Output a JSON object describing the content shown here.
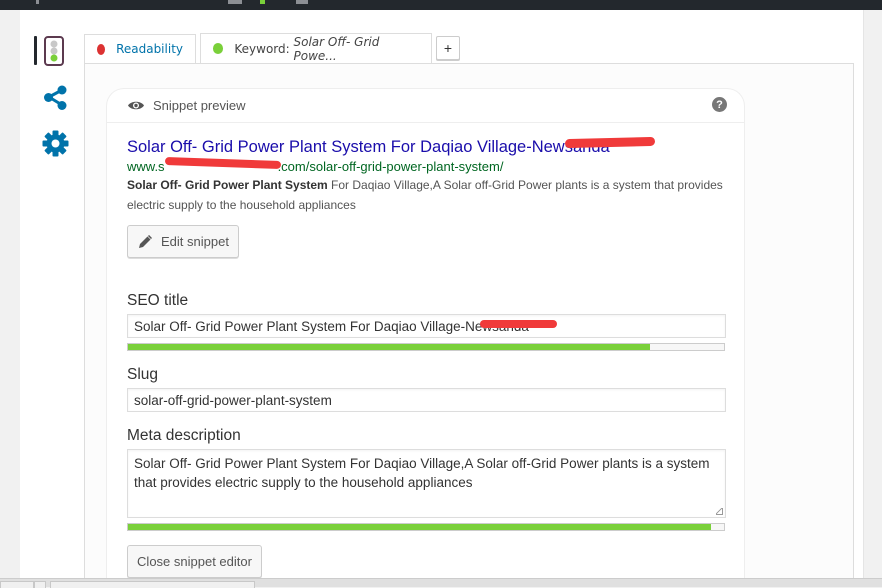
{
  "colors": {
    "readability_status": "#dc3232",
    "keyword_status": "#7ad03a",
    "accent": "#0073aa",
    "serp_title": "#1a0dab",
    "serp_url": "#006621",
    "progress_good": "#7ad03a"
  },
  "sidebar": {
    "items": [
      {
        "icon": "traffic-light-icon",
        "active": true
      },
      {
        "icon": "share-icon"
      },
      {
        "icon": "gear-icon"
      }
    ]
  },
  "tabs": {
    "readability": {
      "label": "Readability",
      "status": "bad"
    },
    "keyword": {
      "prefix": "Keyword: ",
      "keyphrase": "Solar Off- Grid Powe...",
      "status": "good"
    },
    "add_label": "+"
  },
  "snippet": {
    "header": "Snippet preview",
    "help_icon": "?",
    "title": "Solar Off- Grid Power Plant System For Daqiao Village-Newsanda",
    "url_prefix": "www.s",
    "url_suffix": ".com/solar-off-grid-power-plant-system/",
    "desc_bold": "Solar Off- Grid Power Plant System",
    "desc_rest": " For Daqiao Village,A Solar off-Grid Power plants is a system that provides electric supply to the household appliances",
    "edit_button": "Edit snippet"
  },
  "editor": {
    "seo_title": {
      "label": "SEO title",
      "value": "Solar Off- Grid Power Plant System For Daqiao Village-Newsanda",
      "progress": 0.876
    },
    "slug": {
      "label": "Slug",
      "value": "solar-off-grid-power-plant-system"
    },
    "meta_description": {
      "label": "Meta description",
      "value": "Solar Off- Grid Power Plant System For Daqiao Village,A Solar off-Grid Power plants is a system that provides electric supply to the household appliances",
      "progress": 0.978
    },
    "close_button": "Close snippet editor"
  }
}
